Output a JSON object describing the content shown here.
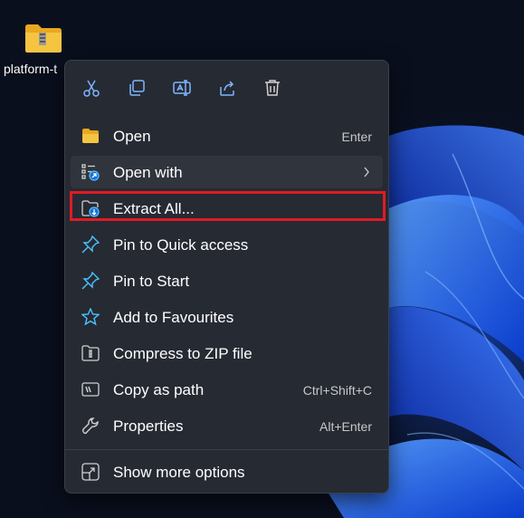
{
  "desktop": {
    "icon_label": "platform-t",
    "icon_type": "zip-folder-icon"
  },
  "quick_actions": [
    {
      "name": "cut-icon"
    },
    {
      "name": "copy-icon"
    },
    {
      "name": "rename-icon"
    },
    {
      "name": "share-icon"
    },
    {
      "name": "delete-icon"
    }
  ],
  "menu": {
    "open": {
      "label": "Open",
      "shortcut": "Enter"
    },
    "open_with": {
      "label": "Open with"
    },
    "extract_all": {
      "label": "Extract All..."
    },
    "pin_quick": {
      "label": "Pin to Quick access"
    },
    "pin_start": {
      "label": "Pin to Start"
    },
    "favourites": {
      "label": "Add to Favourites"
    },
    "compress": {
      "label": "Compress to ZIP file"
    },
    "copy_path": {
      "label": "Copy as path",
      "shortcut": "Ctrl+Shift+C"
    },
    "properties": {
      "label": "Properties",
      "shortcut": "Alt+Enter"
    },
    "more_options": {
      "label": "Show more options"
    }
  },
  "colors": {
    "menu_bg": "#262a33",
    "accent_blue": "#4cc2ff",
    "highlight_red": "#e01b24",
    "folder_yellow": "#f5c542"
  }
}
